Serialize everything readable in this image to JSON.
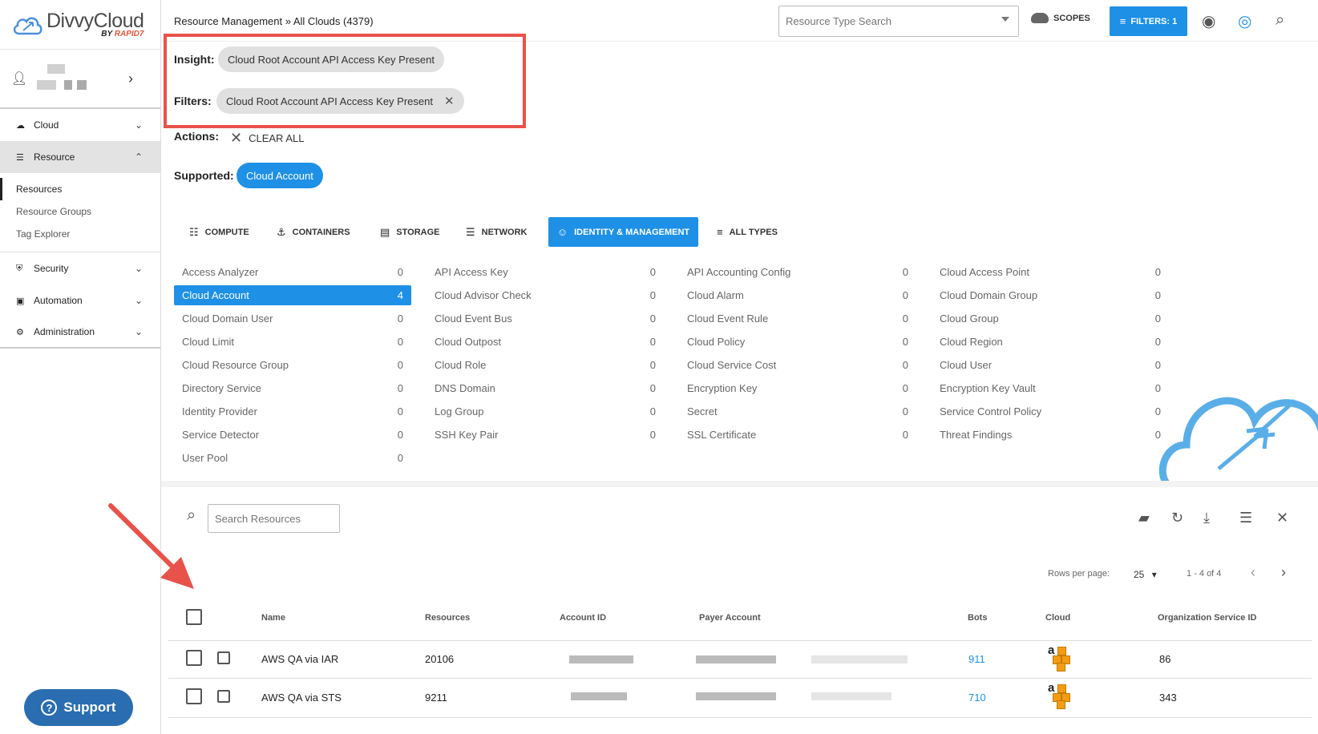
{
  "logo": {
    "name": "DivvyCloud",
    "by": "BY ",
    "brand": "RAPID7"
  },
  "sidebar": {
    "items": [
      {
        "label": "Cloud",
        "icon": "cloud-icon"
      },
      {
        "label": "Resource",
        "icon": "list-icon"
      },
      {
        "label": "Security",
        "icon": "shield-icon"
      },
      {
        "label": "Automation",
        "icon": "lock-icon"
      },
      {
        "label": "Administration",
        "icon": "gear-icon"
      }
    ],
    "resource_sub": [
      "Resources",
      "Resource Groups",
      "Tag Explorer"
    ],
    "support": "Support"
  },
  "header": {
    "breadcrumb": "Resource Management » All Clouds (4379)",
    "type_search_placeholder": "Resource Type Search",
    "scopes": "SCOPES",
    "filters": "FILTERS: 1"
  },
  "filters": {
    "insight_label": "Insight:",
    "insight_value": "Cloud Root Account API Access Key Present",
    "filters_label": "Filters:",
    "filters_value": "Cloud Root Account API Access Key Present",
    "actions_label": "Actions:",
    "clear_all": "CLEAR ALL",
    "supported_label": "Supported:",
    "supported_value": "Cloud Account"
  },
  "tabs": [
    "COMPUTE",
    "CONTAINERS",
    "STORAGE",
    "NETWORK",
    "IDENTITY & MANAGEMENT",
    "ALL TYPES"
  ],
  "types": [
    [
      [
        "Access Analyzer",
        "0"
      ],
      [
        "Cloud Account",
        "4"
      ],
      [
        "Cloud Domain User",
        "0"
      ],
      [
        "Cloud Limit",
        "0"
      ],
      [
        "Cloud Resource Group",
        "0"
      ],
      [
        "Directory Service",
        "0"
      ],
      [
        "Identity Provider",
        "0"
      ],
      [
        "Service Detector",
        "0"
      ],
      [
        "User Pool",
        "0"
      ]
    ],
    [
      [
        "API Access Key",
        "0"
      ],
      [
        "Cloud Advisor Check",
        "0"
      ],
      [
        "Cloud Event Bus",
        "0"
      ],
      [
        "Cloud Outpost",
        "0"
      ],
      [
        "Cloud Role",
        "0"
      ],
      [
        "DNS Domain",
        "0"
      ],
      [
        "Log Group",
        "0"
      ],
      [
        "SSH Key Pair",
        "0"
      ]
    ],
    [
      [
        "API Accounting Config",
        "0"
      ],
      [
        "Cloud Alarm",
        "0"
      ],
      [
        "Cloud Event Rule",
        "0"
      ],
      [
        "Cloud Policy",
        "0"
      ],
      [
        "Cloud Service Cost",
        "0"
      ],
      [
        "Encryption Key",
        "0"
      ],
      [
        "Secret",
        "0"
      ],
      [
        "SSL Certificate",
        "0"
      ]
    ],
    [
      [
        "Cloud Access Point",
        "0"
      ],
      [
        "Cloud Domain Group",
        "0"
      ],
      [
        "Cloud Group",
        "0"
      ],
      [
        "Cloud Region",
        "0"
      ],
      [
        "Cloud User",
        "0"
      ],
      [
        "Encryption Key Vault",
        "0"
      ],
      [
        "Service Control Policy",
        "0"
      ],
      [
        "Threat Findings",
        "0"
      ]
    ]
  ],
  "resources": {
    "search_placeholder": "Search Resources",
    "rows_per_page_label": "Rows per page:",
    "rows_per_page": "25",
    "range": "1 - 4 of 4",
    "columns": [
      "Name",
      "Resources",
      "Account ID",
      "Payer Account",
      "Bots",
      "Cloud",
      "Organization Service ID"
    ],
    "rows": [
      {
        "name": "AWS QA via IAR",
        "resources": "20106",
        "bots": "911",
        "org": "86"
      },
      {
        "name": "AWS QA via STS",
        "resources": "9211",
        "bots": "710",
        "org": "343"
      }
    ]
  },
  "colors": {
    "accent": "#1e90e6",
    "highlight": "#e8524a"
  }
}
